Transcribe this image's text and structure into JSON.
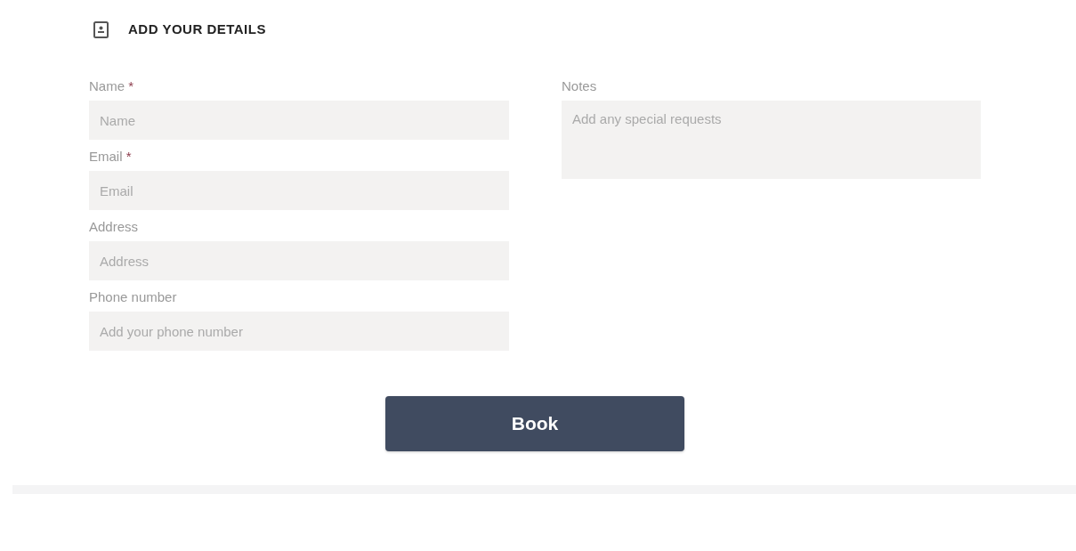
{
  "section": {
    "title": "ADD YOUR DETAILS"
  },
  "left_fields": [
    {
      "label": "Name",
      "required_mark": "*",
      "placeholder": "Name"
    },
    {
      "label": "Email",
      "required_mark": "*",
      "placeholder": "Email"
    },
    {
      "label": "Address",
      "placeholder": "Address"
    },
    {
      "label": "Phone number",
      "placeholder": "Add your phone number"
    }
  ],
  "notes": {
    "label": "Notes",
    "placeholder": "Add any special requests"
  },
  "submit_button": "Book"
}
